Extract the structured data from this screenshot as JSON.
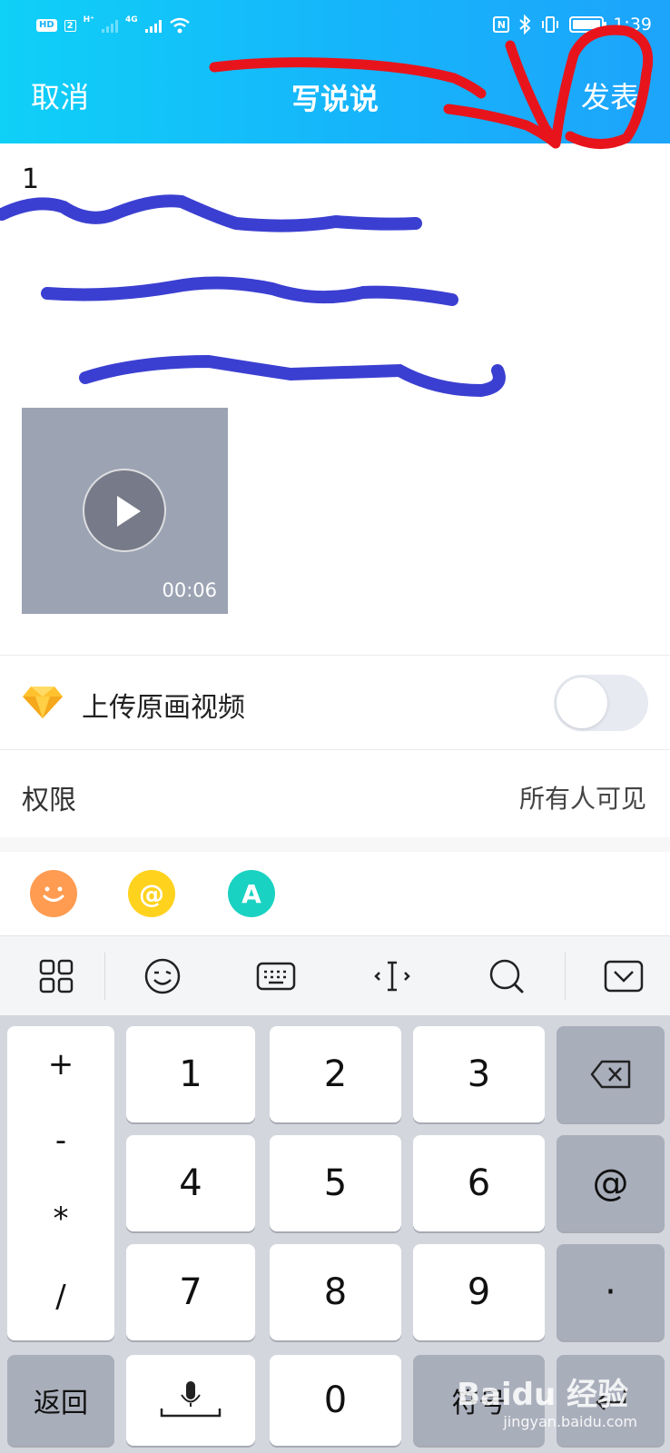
{
  "status_bar": {
    "hd": "HD",
    "sim": "2",
    "net1": "H⁺",
    "net2": "4G",
    "time": "1:39"
  },
  "header": {
    "cancel": "取消",
    "title": "写说说",
    "post": "发表"
  },
  "editor": {
    "text": "1"
  },
  "video": {
    "duration": "00:06"
  },
  "upload_original": {
    "label": "上传原画视频",
    "enabled": false
  },
  "permission": {
    "label": "权限",
    "value": "所有人可见"
  },
  "tool_row": {
    "emoji": "☺",
    "at": "@",
    "font": "A"
  },
  "keyboard": {
    "symbols": [
      "+",
      "-",
      "*",
      "/"
    ],
    "digits": [
      "1",
      "2",
      "3",
      "4",
      "5",
      "6",
      "7",
      "8",
      "9",
      "0"
    ],
    "at": "@",
    "dot": "·",
    "back": "返回",
    "symbol": "符号"
  },
  "watermark": {
    "brand": "Baidu 经验",
    "url": "jingyan.baidu.com"
  },
  "colors": {
    "header_start": "#0fd0f7",
    "header_end": "#1da4fb",
    "annotation_red": "#e8141c",
    "annotation_blue": "#3b3fd1"
  }
}
